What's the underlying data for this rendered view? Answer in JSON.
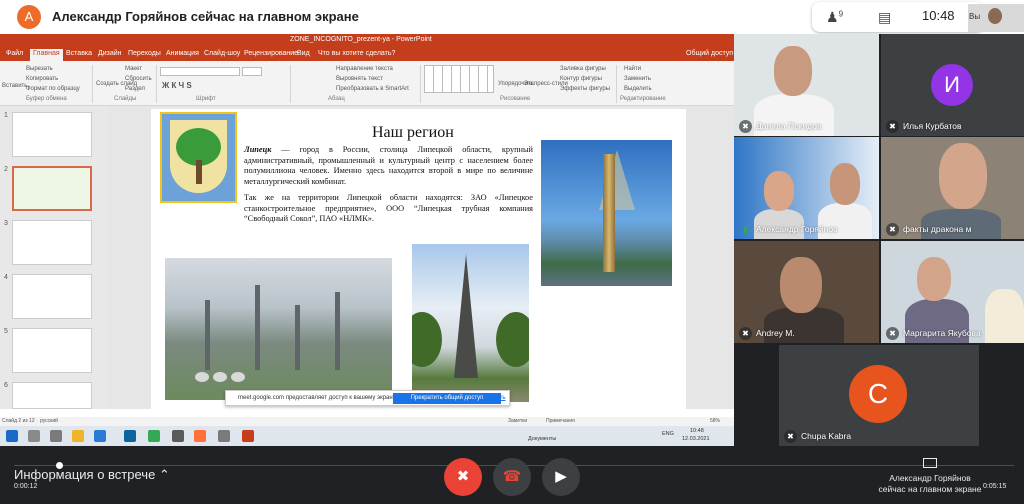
{
  "meet": {
    "avatar_letter": "А",
    "presenter_title": "Александр Горяйнов сейчас на главном экране",
    "participant_count": "9",
    "clock": "10:48",
    "self_label": "Вы"
  },
  "powerpoint": {
    "window_title": "ZONE_INCOGNITO_prezent-ya - PowerPoint",
    "tabs": [
      "Файл",
      "Главная",
      "Вставка",
      "Дизайн",
      "Переходы",
      "Анимация",
      "Слайд-шоу",
      "Рецензирование",
      "Вид",
      "Что вы хотите сделать?"
    ],
    "share_label": "Общий доступ",
    "ribbon_groups": [
      "Буфер обмена",
      "Слайды",
      "Шрифт",
      "Абзац",
      "Рисование",
      "Редактирование"
    ],
    "ribbon_items": [
      "Вырезать",
      "Копировать",
      "Формат по образцу",
      "Вставить",
      "Создать слайд",
      "Макет",
      "Сбросить",
      "Раздел",
      "Направление текста",
      "Выровнять текст",
      "Преобразовать в SmartArt",
      "Упорядочить",
      "Экспресс-стили",
      "Заливка фигуры",
      "Контур фигуры",
      "Эффекты фигуры",
      "Найти",
      "Заменить",
      "Выделить"
    ],
    "thumbnail_numbers": [
      "1",
      "2",
      "3",
      "4",
      "5",
      "6"
    ],
    "status_left": "Слайд 2 из 12",
    "status_lang": "русский",
    "status_notes": "Заметки",
    "status_comments": "Примечания",
    "zoom": "58%"
  },
  "slide": {
    "title": "Наш регион",
    "para1_lead": "Липецк",
    "para1_rest": " — город в России, столица Липецкой области, крупный административный, промышленный и культурный центр с населением более полумиллиона человек. Именно здесь находится второй в мире по величине металлургический комбинат.",
    "para2": "Так же на территории Липецкой области находятся: ЗАО «Липецкое станкостроительное предприятие», ООО “Липецкая трубная компания “Свободный Сокол”, ПАО «НЛМК»."
  },
  "share_banner": {
    "message": "meet.google.com предоставляет доступ к вашему экрану.",
    "stop_button": "Прекратить общий доступ",
    "hide_link": "Скрыть"
  },
  "taskbar": {
    "docs_label": "Документы",
    "lang": "ENG",
    "time": "10:48",
    "date": "12.03.2021"
  },
  "participants": [
    {
      "name": "Данила Покидов"
    },
    {
      "name": "Илья Курбатов",
      "initial": "И"
    },
    {
      "name": "Александр Горяйнов"
    },
    {
      "name": "факты дракона м"
    },
    {
      "name": "Andrey M."
    },
    {
      "name": "Маргарита Якубова"
    },
    {
      "name": "Chupa Kabra",
      "initial": "C"
    }
  ],
  "bottom": {
    "meeting_info": "Информация о встрече",
    "time_elapsed": "0:00:12",
    "time_remaining": "0:05:15",
    "presenting_line1": "Александр Горяйнов",
    "presenting_line2": "сейчас на главном экране"
  },
  "colors": {
    "ppt_red": "#c43e1c",
    "meet_red": "#ea4335",
    "meet_blue": "#1a73e8",
    "avatar_purple": "#9334e6",
    "avatar_orange": "#e8541e"
  }
}
